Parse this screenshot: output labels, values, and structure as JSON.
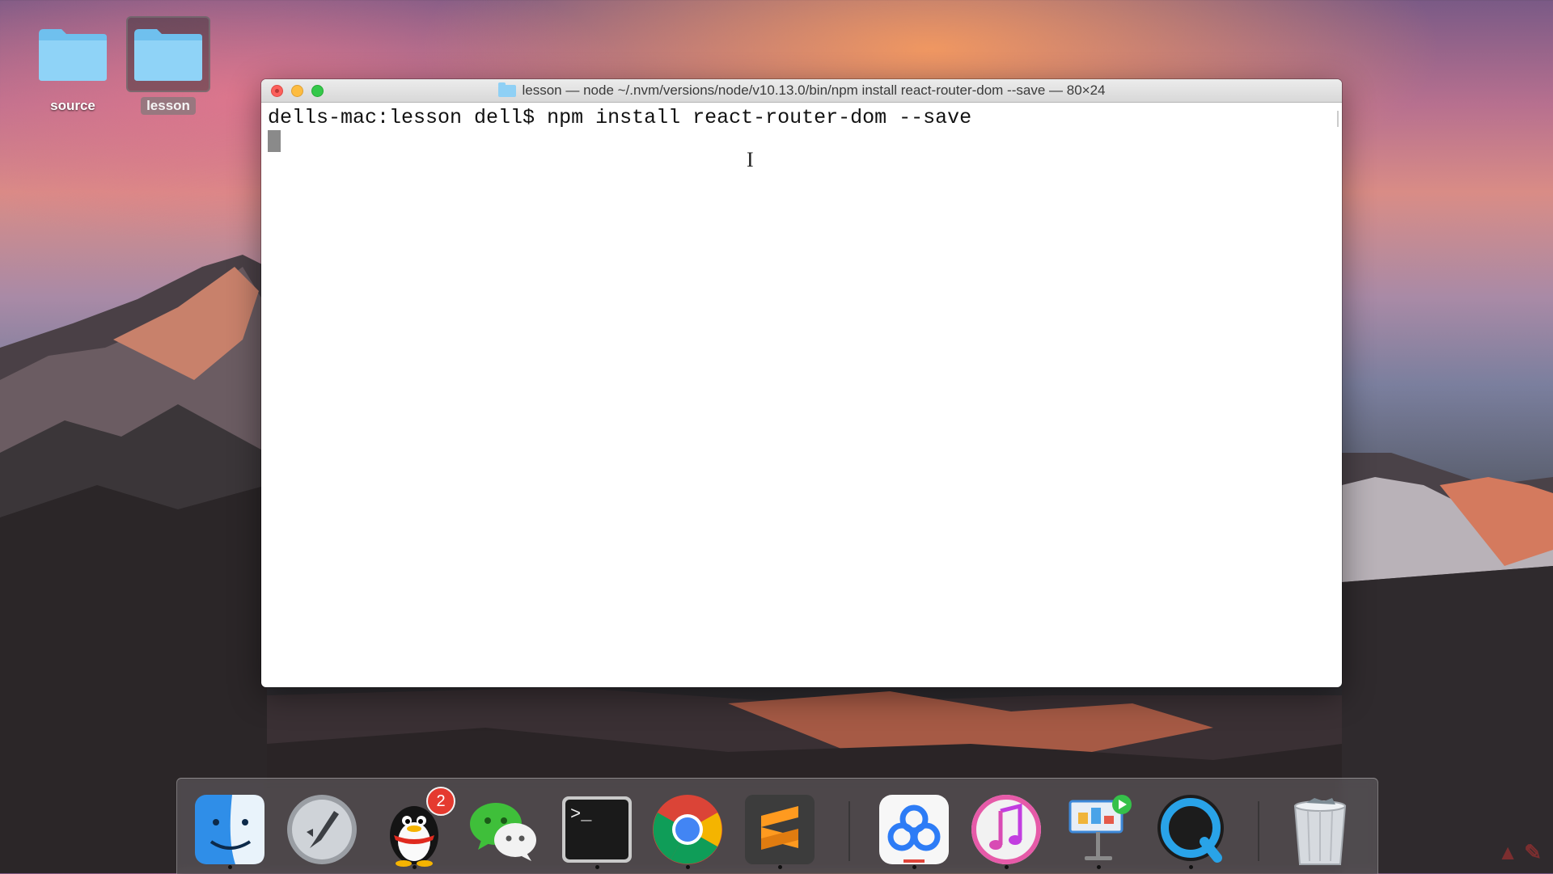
{
  "desktop": {
    "icons": [
      {
        "label": "source",
        "selected": false
      },
      {
        "label": "lesson",
        "selected": true
      }
    ]
  },
  "terminal": {
    "title": "lesson — node ~/.nvm/versions/node/v10.13.0/bin/npm install react-router-dom --save — 80×24",
    "prompt": "dells-mac:lesson dell$",
    "command": "npm install react-router-dom --save"
  },
  "dock": {
    "apps": [
      {
        "name": "finder-icon"
      },
      {
        "name": "launchpad-icon"
      },
      {
        "name": "qq-icon",
        "badge": "2"
      },
      {
        "name": "wechat-icon"
      },
      {
        "name": "terminal-icon",
        "text": ">_"
      },
      {
        "name": "chrome-icon"
      },
      {
        "name": "sublime-text-icon"
      },
      {
        "name": "baidu-netdisk-icon"
      },
      {
        "name": "itunes-icon"
      },
      {
        "name": "keynote-icon"
      },
      {
        "name": "quicktime-icon"
      },
      {
        "name": "trash-icon"
      }
    ]
  },
  "colors": {
    "folder": "#7fcbf2",
    "close": "#fc605c",
    "minimize": "#fdbc40",
    "maximize": "#34c84a"
  }
}
